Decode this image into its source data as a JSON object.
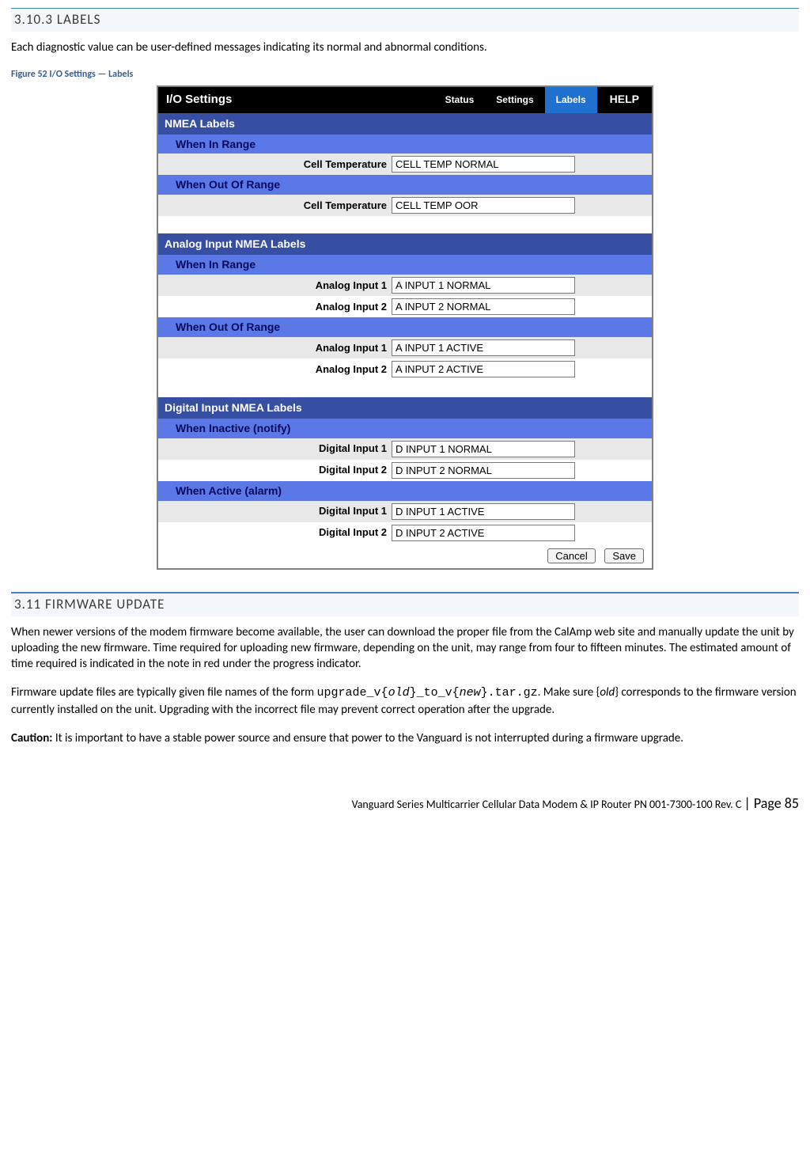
{
  "sections": {
    "labels": {
      "heading": "3.10.3  LABELS",
      "intro": "Each diagnostic value can be user-defined messages indicating its normal and abnormal conditions.",
      "figure_caption": "Figure 52 I/O Settings — Labels"
    },
    "firmware": {
      "heading": "3.11   FIRMWARE  UPDATE",
      "para1": "When newer versions of the modem firmware become available, the user can download the proper file from the CalAmp web site and manually update the unit by uploading the new firmware. Time required for uploading new firmware, depending on the unit, may range from four to fifteen minutes. The estimated amount of time required is indicated in the note in red under the progress indicator.",
      "para2_pre": "Firmware update files are typically given file names of the form ",
      "para2_code1": "upgrade_v{",
      "para2_old": "old",
      "para2_code2": "}_to_v{",
      "para2_new": "new",
      "para2_code3": "}.tar.gz",
      "para2_post": ". Make sure {",
      "para2_old2": "old",
      "para2_post2": "} corresponds to the firmware version currently installed on the unit. Upgrading with the incorrect file may prevent correct operation after the upgrade.",
      "caution_label": "Caution:",
      "caution_text": " It is important to have a stable power source and ensure that power to the Vanguard  is not interrupted during a firmware upgrade."
    }
  },
  "panel": {
    "title": "I/O Settings",
    "tabs": {
      "status": "Status",
      "settings": "Settings",
      "labels": "Labels",
      "help": "HELP"
    },
    "groups": {
      "nmea": {
        "header": "NMEA Labels",
        "in_range": "When In Range",
        "cell_temp_label": "Cell Temperature",
        "cell_temp_in": "CELL TEMP NORMAL",
        "out_range": "When Out Of Range",
        "cell_temp_out": "CELL TEMP OOR"
      },
      "analog": {
        "header": "Analog Input NMEA Labels",
        "in_range": "When In Range",
        "out_range": "When Out Of Range",
        "ai1_label": "Analog Input 1",
        "ai2_label": "Analog Input 2",
        "ai1_in": "A INPUT 1 NORMAL",
        "ai2_in": "A INPUT 2 NORMAL",
        "ai1_out": "A INPUT 1 ACTIVE",
        "ai2_out": "A INPUT 2 ACTIVE"
      },
      "digital": {
        "header": "Digital Input NMEA Labels",
        "inactive": "When Inactive (notify)",
        "active": "When Active (alarm)",
        "di1_label": "Digital Input 1",
        "di2_label": "Digital Input 2",
        "di1_in": "D INPUT 1 NORMAL",
        "di2_in": "D INPUT 2 NORMAL",
        "di1_out": "D INPUT 1 ACTIVE",
        "di2_out": "D INPUT 2 ACTIVE"
      }
    },
    "buttons": {
      "cancel": "Cancel",
      "save": "Save"
    }
  },
  "footer": {
    "text": "Vanguard Series Multicarrier Cellular Data Modem & IP Router PN 001-7300-100 Rev. C ",
    "page_label": "| Page 85"
  }
}
